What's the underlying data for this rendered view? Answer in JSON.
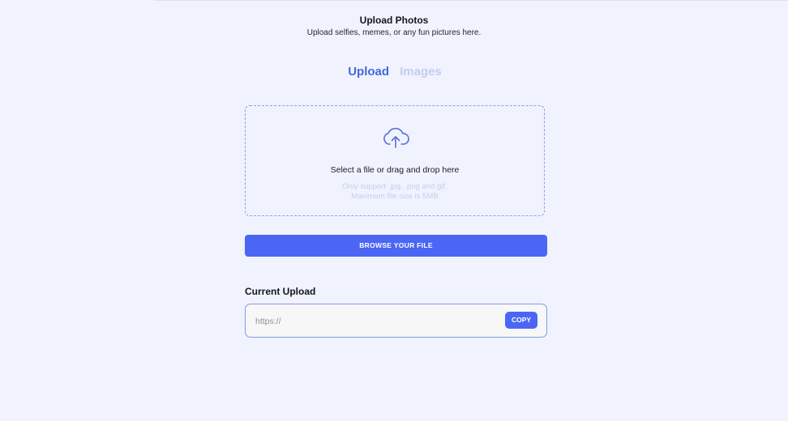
{
  "header": {
    "title": "Upload Photos",
    "subtitle": "Upload selfies, memes, or any fun pictures here."
  },
  "tabs": [
    {
      "label": "Upload",
      "active": true
    },
    {
      "label": "Images",
      "active": false
    }
  ],
  "dropzone": {
    "icon": "cloud-upload-icon",
    "text": "Select a file or drag and drop here",
    "hint_line1": "Only support .jpg, .png and gif.",
    "hint_line2": "Maximum file size is 5MB"
  },
  "browse_button": {
    "label": "BROWSE YOUR FILE"
  },
  "current_upload": {
    "label": "Current Upload",
    "url_placeholder": "https://",
    "copy_label": "COPY"
  },
  "colors": {
    "background": "#f0f3fd",
    "accent": "#4b66f5",
    "tab_active": "#4466e0",
    "tab_inactive": "#c2cdf1",
    "dashed_border": "#8aa0e6"
  }
}
